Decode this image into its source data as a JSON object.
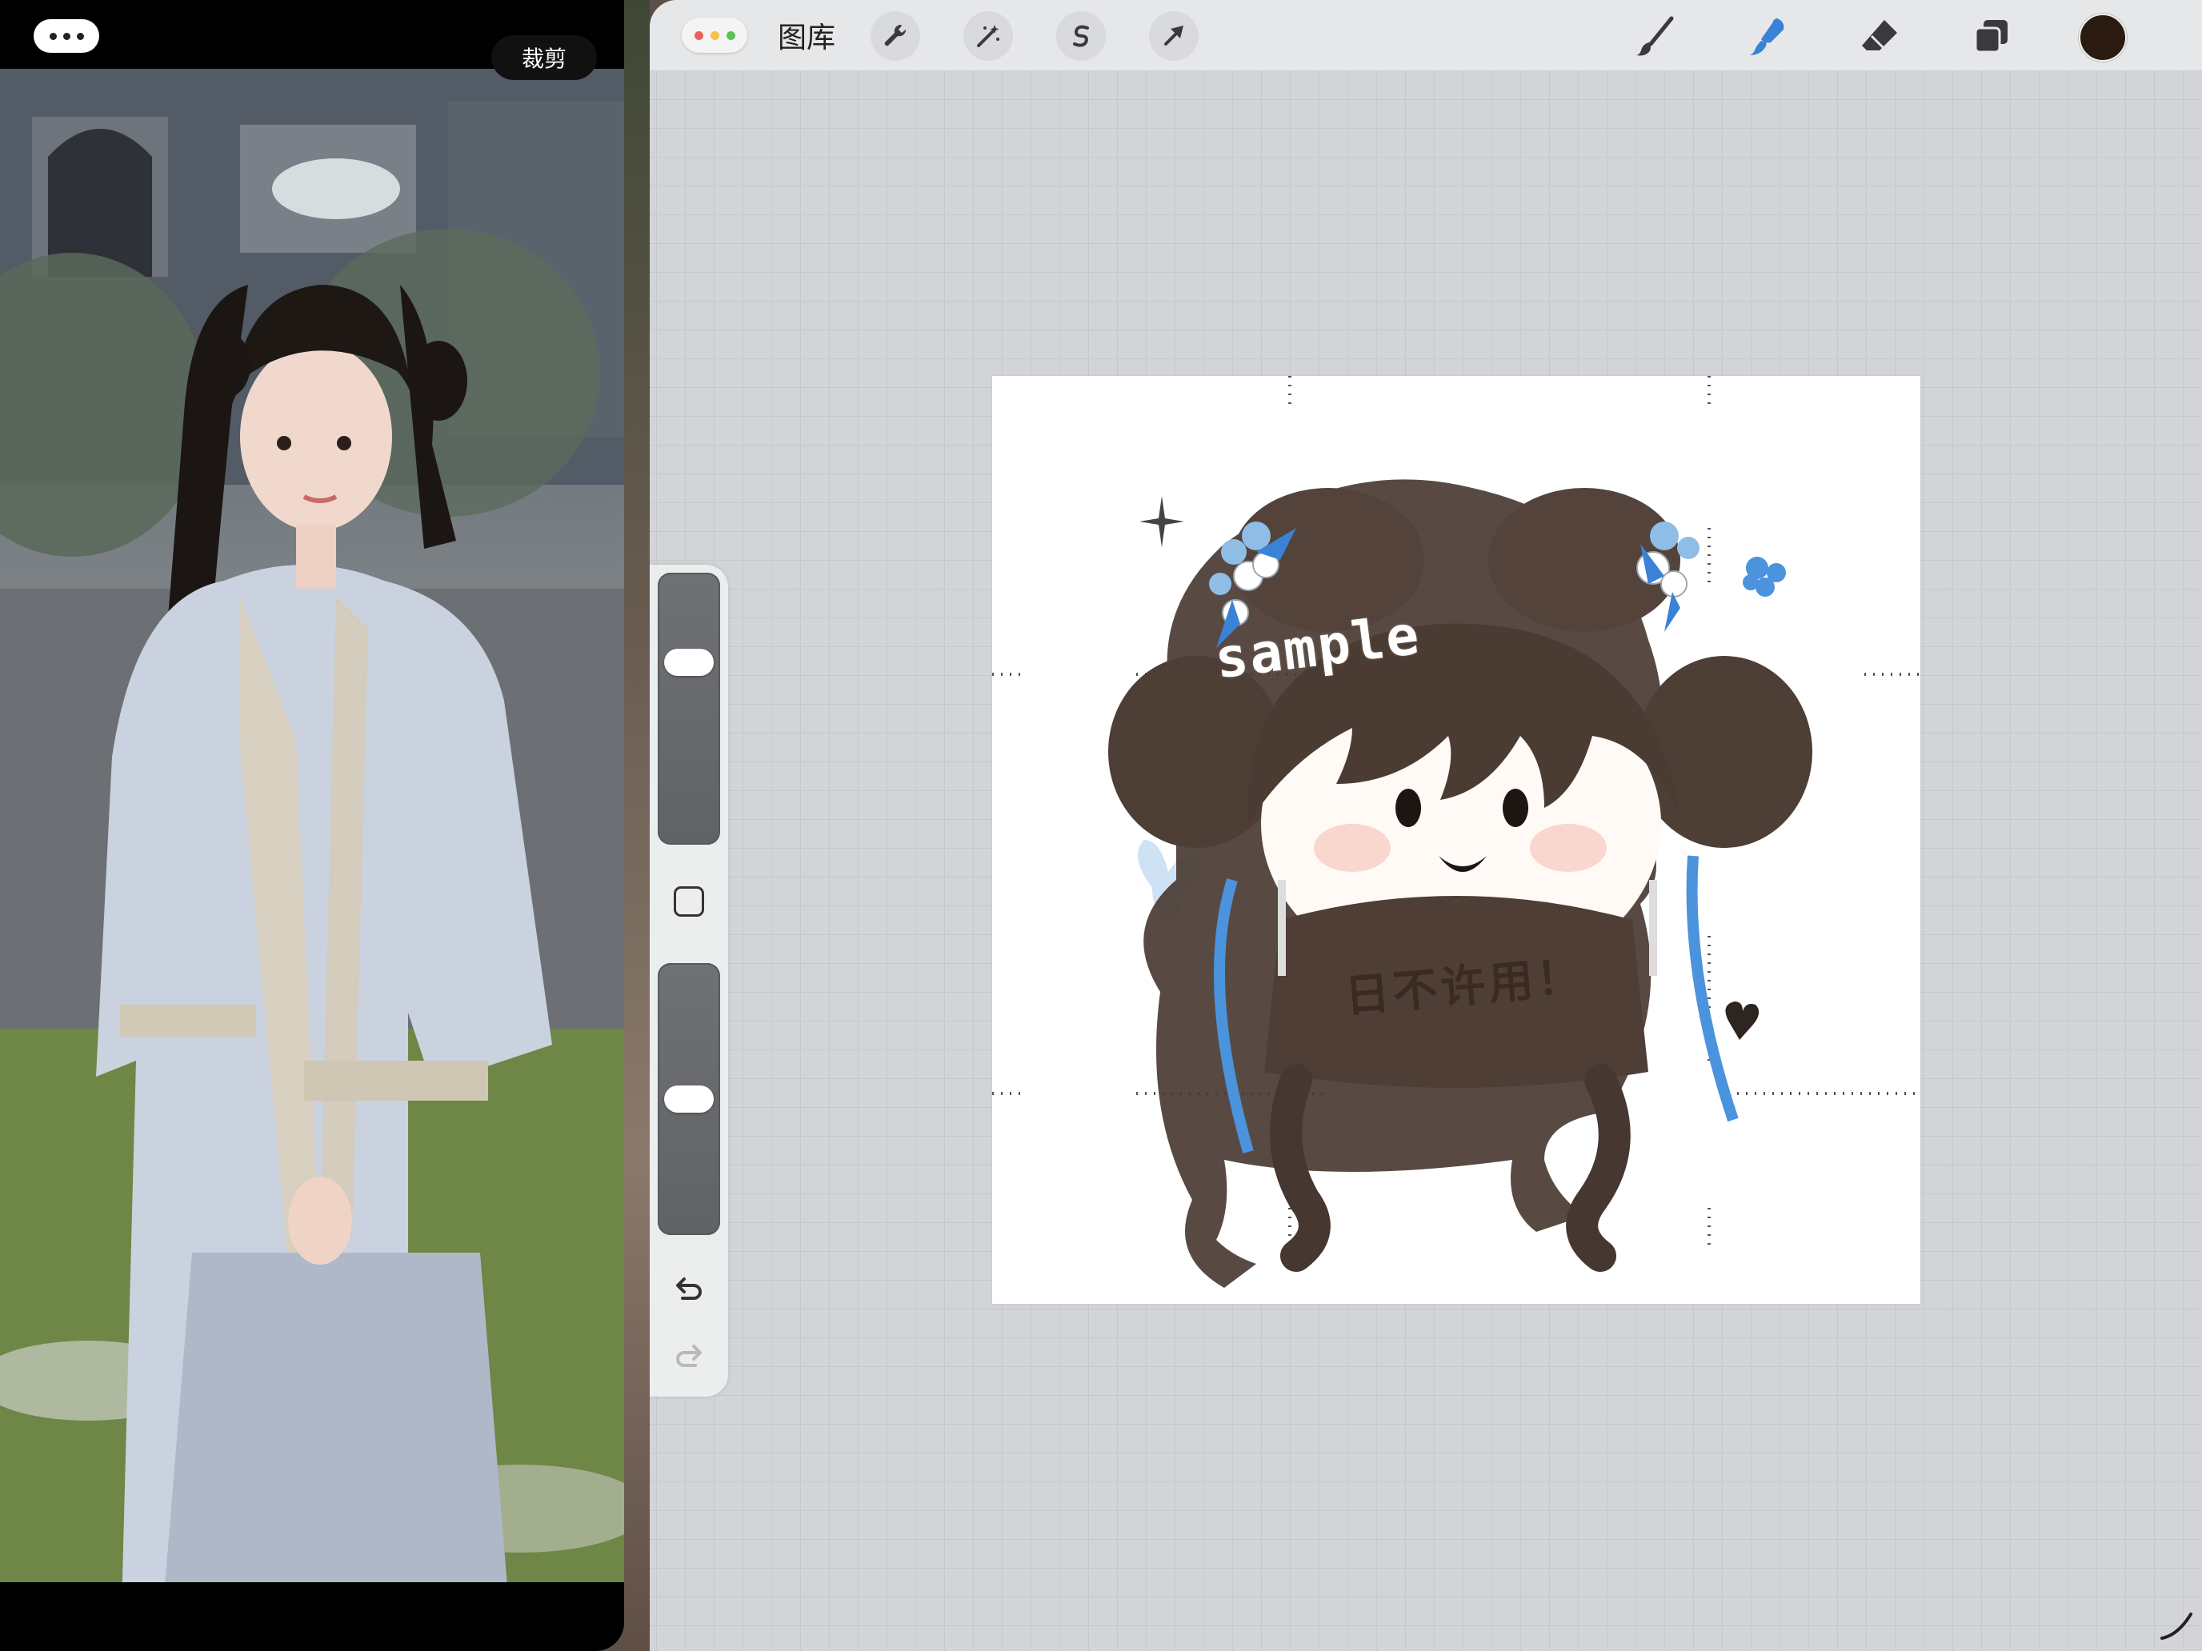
{
  "left_app": {
    "crop_label": "裁剪",
    "more_icon": "more-dots-icon"
  },
  "toolbar": {
    "gallery_label": "图库",
    "left_tools": [
      "wrench-icon",
      "magic-wand-icon",
      "selection-icon",
      "transform-arrow-icon"
    ],
    "right_tools": [
      "brush-icon",
      "smudge-icon",
      "eraser-icon",
      "layers-icon"
    ],
    "active_tool": "smudge-icon",
    "current_color": "#2b1a10"
  },
  "sidebar": {
    "size_slider_level": 0.3,
    "opacity_slider_level": 0.5,
    "undo_icon": "undo-icon",
    "redo_icon": "redo-icon"
  },
  "canvas": {
    "sample_text": "sample",
    "shirt_text": "日不许用！"
  },
  "colors": {
    "accent_blue": "#3a82d6",
    "hair_brown": "#4a3b33",
    "ribbon_blue": "#4b93dd"
  }
}
